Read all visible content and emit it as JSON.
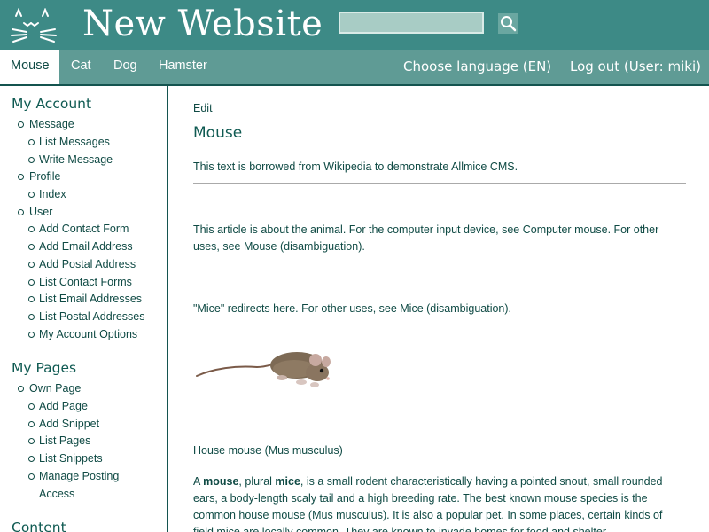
{
  "header": {
    "title": "New Website",
    "logo_icon": "cat-face-icon",
    "search": {
      "value": "",
      "placeholder": ""
    },
    "search_icon": "search-icon"
  },
  "nav": {
    "tabs": [
      {
        "label": "Mouse",
        "active": true
      },
      {
        "label": "Cat",
        "active": false
      },
      {
        "label": "Dog",
        "active": false
      },
      {
        "label": "Hamster",
        "active": false
      }
    ],
    "language": "Choose language (EN)",
    "logout": "Log out (User: miki)"
  },
  "sidebar": {
    "my_account": {
      "heading": "My Account",
      "message": "Message",
      "list_messages": "List Messages",
      "write_message": "Write Message",
      "profile": "Profile",
      "index": "Index",
      "user": "User",
      "add_contact_form": "Add Contact Form",
      "add_email_address": "Add Email Address",
      "add_postal_address": "Add Postal Address",
      "list_contact_forms": "List Contact Forms",
      "list_email_addresses": "List Email Addresses",
      "list_postal_addresses": "List Postal Addresses",
      "my_account_options": "My Account Options"
    },
    "my_pages": {
      "heading": "My Pages",
      "own_page": "Own Page",
      "add_page": "Add Page",
      "add_snippet": "Add Snippet",
      "list_pages": "List Pages",
      "list_snippets": "List Snippets",
      "manage_posting": "Manage Posting",
      "access": "Access"
    },
    "content": {
      "heading": "Content"
    }
  },
  "main": {
    "edit": "Edit",
    "title": "Mouse",
    "borrowed": "This text is borrowed from Wikipedia to demonstrate Allmice CMS.",
    "about_1": "This article is about the animal. For the computer input device, see Computer mouse. For other",
    "about_2": "uses, see Mouse (disambiguation).",
    "redirect": "\"Mice\" redirects here. For other uses, see Mice (disambiguation).",
    "caption": "House mouse (Mus musculus)",
    "para_a": "A ",
    "para_mouse": "mouse",
    "para_b": ", plural ",
    "para_mice": "mice",
    "para_c": ", is a small rodent characteristically having a pointed snout, small rounded",
    "para_line2": "ears, a body-length scaly tail and a high breeding rate. The best known mouse species is the",
    "para_line3": "common house mouse (Mus musculus). It is also a popular pet. In some places, certain kinds of",
    "para_line4": "field mice are locally common. They are known to invade homes for food and shelter."
  }
}
